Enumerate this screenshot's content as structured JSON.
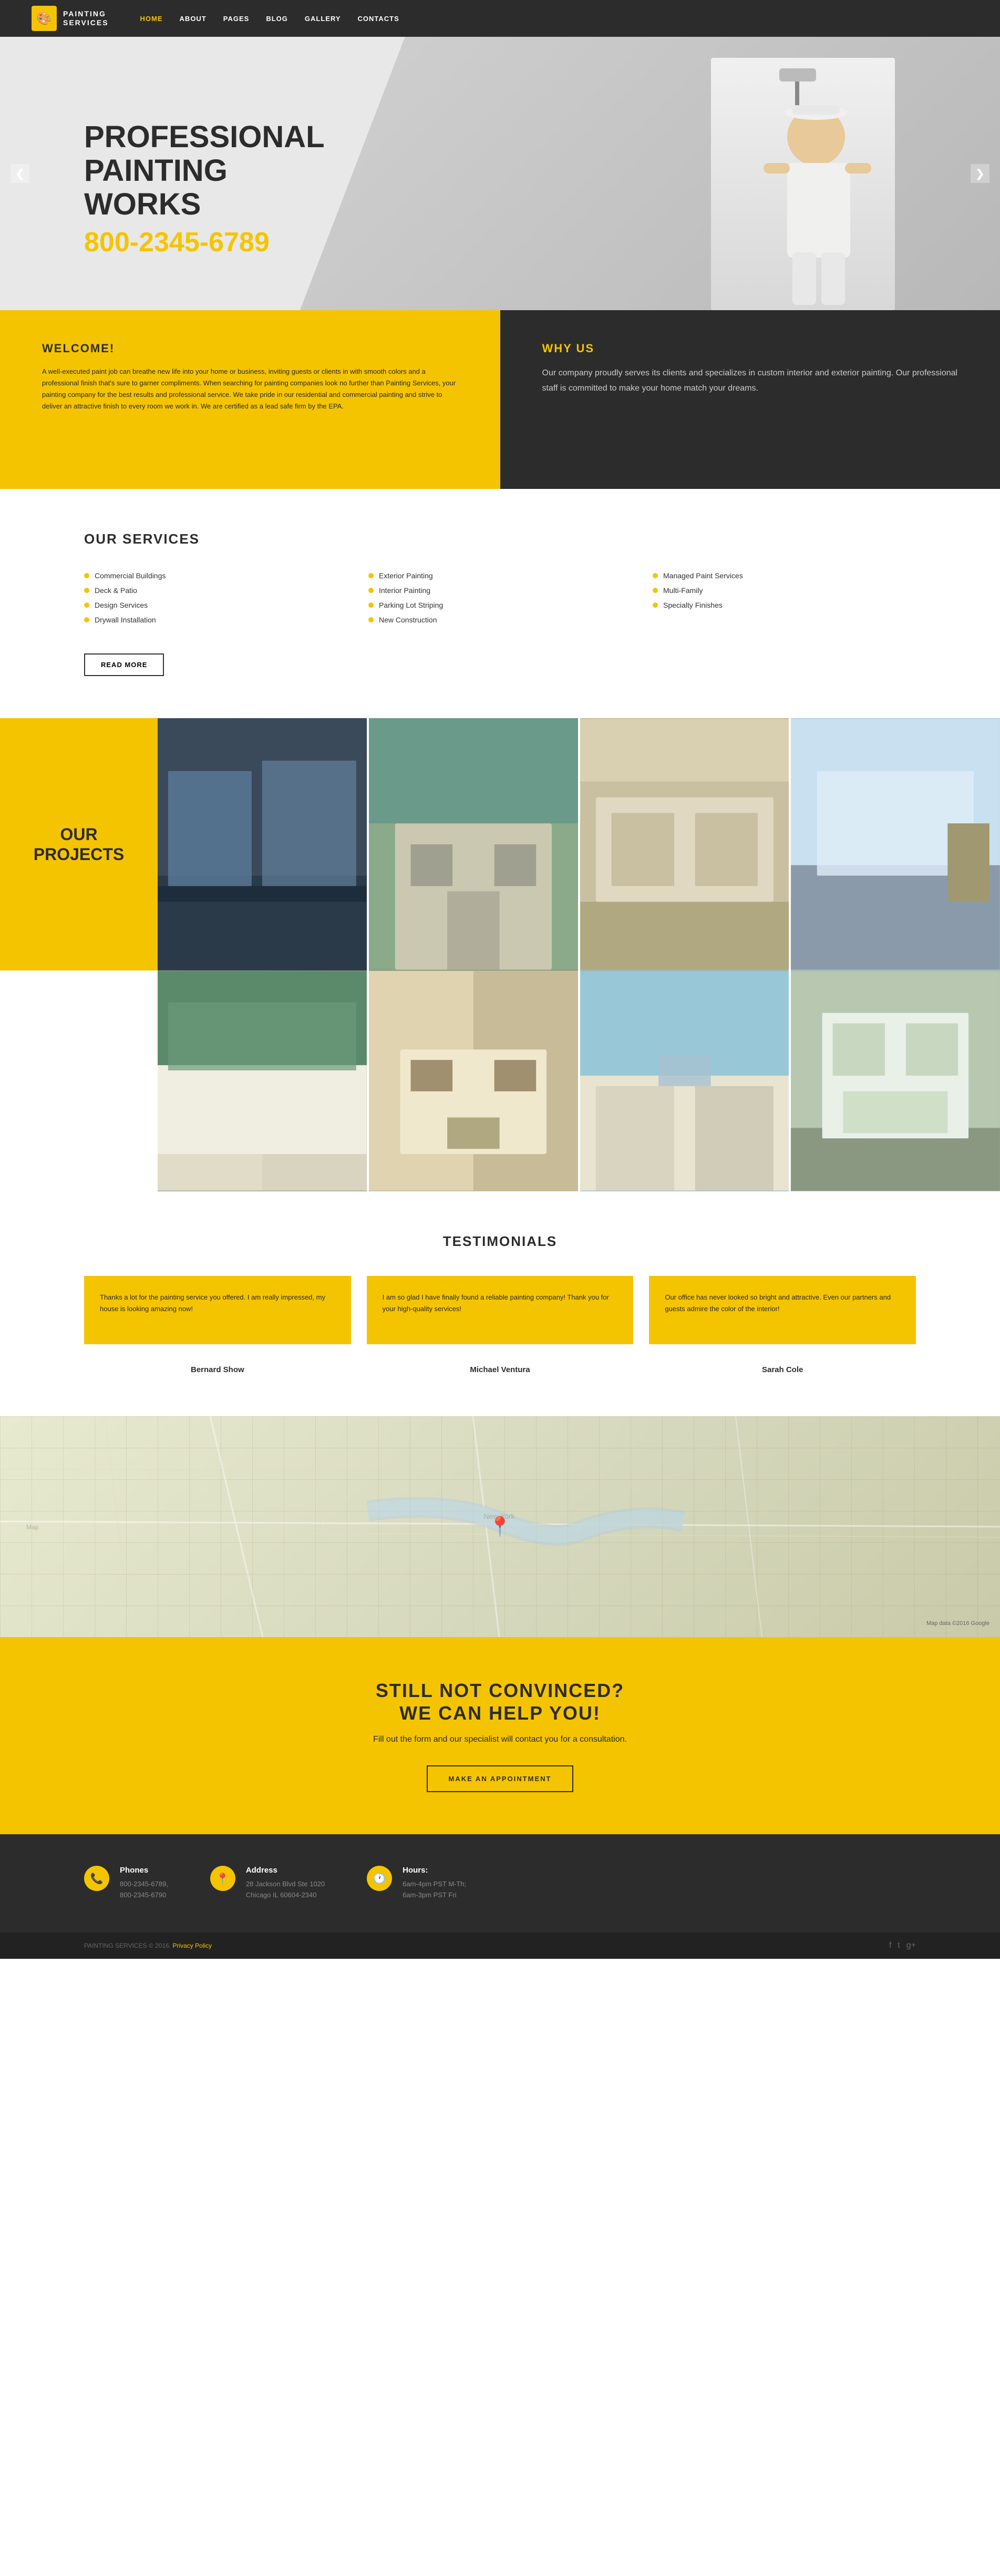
{
  "header": {
    "logo_icon": "🎨",
    "logo_line1": "PAINTING",
    "logo_line2": "SERVICES",
    "nav": [
      {
        "label": "HOME",
        "active": true
      },
      {
        "label": "ABOUT",
        "active": false
      },
      {
        "label": "PAGES",
        "active": false
      },
      {
        "label": "BLOG",
        "active": false
      },
      {
        "label": "GALLERY",
        "active": false
      },
      {
        "label": "CONTACTS",
        "active": false
      }
    ]
  },
  "hero": {
    "title_line1": "PROFESSIONAL",
    "title_line2": "PAINTING WORKS",
    "phone": "800-2345-6789",
    "arrow_left": "❮",
    "arrow_right": "❯"
  },
  "welcome": {
    "title": "WELCOME!",
    "text": "A well-executed paint job can breathe new life into your home or business, inviting guests or clients in with smooth colors and a professional finish that's sure to garner compliments. When searching for painting companies look no further than Painting Services, your painting company for the best results and professional service. We take pride in our residential and commercial painting and strive to deliver an attractive finish to every room we work in. We are certified as a lead safe firm by the EPA."
  },
  "why_us": {
    "title": "WHY US",
    "text": "Our company proudly serves its clients and specializes in custom interior and exterior painting. Our professional staff is committed to make your home match your dreams."
  },
  "services": {
    "section_title": "OUR SERVICES",
    "items": [
      "Commercial Buildings",
      "Deck & Patio",
      "Design Services",
      "Drywall Installation",
      "Exterior Painting",
      "Interior Painting",
      "Parking Lot Striping",
      "New Construction",
      "Managed Paint Services",
      "Multi-Family",
      "Specialty Finishes"
    ],
    "read_more_label": "READ MORE"
  },
  "projects": {
    "section_title_line1": "OUR",
    "section_title_line2": "PROJECTS"
  },
  "testimonials": {
    "section_title": "TESTIMONIALS",
    "items": [
      {
        "text": "Thanks a lot for the painting service you offered. I am really impressed, my house is looking amazing now!",
        "name": "Bernard Show"
      },
      {
        "text": "I am so glad I have finally found a reliable painting company! Thank you for your high-quality services!",
        "name": "Michael Ventura"
      },
      {
        "text": "Our office has never looked so bright and attractive. Even our partners and guests admire the color of the interior!",
        "name": "Sarah Cole"
      }
    ]
  },
  "cta": {
    "title_line1": "STILL NOT CONVINCED?",
    "title_line2": "WE CAN HELP YOU!",
    "subtitle": "Fill out the form and our specialist will contact you for a consultation.",
    "button_label": "MAKE AN APPOINTMENT"
  },
  "footer": {
    "columns": [
      {
        "icon": "📞",
        "title": "Phones",
        "lines": [
          "800-2345-6789,",
          "800-2345-6790"
        ]
      },
      {
        "icon": "📍",
        "title": "Address",
        "lines": [
          "28 Jackson Blvd Ste 1020",
          "Chicago IL 60604-2340"
        ]
      },
      {
        "icon": "🕐",
        "title": "Hours:",
        "lines": [
          "6am-4pm PST M-Th;",
          "6am-3pm PST Fri"
        ]
      }
    ],
    "bottom_text": "PAINTING SERVICES © 2016.",
    "privacy_label": "Privacy Policy",
    "social_icons": [
      "f",
      "t",
      "g+"
    ]
  }
}
